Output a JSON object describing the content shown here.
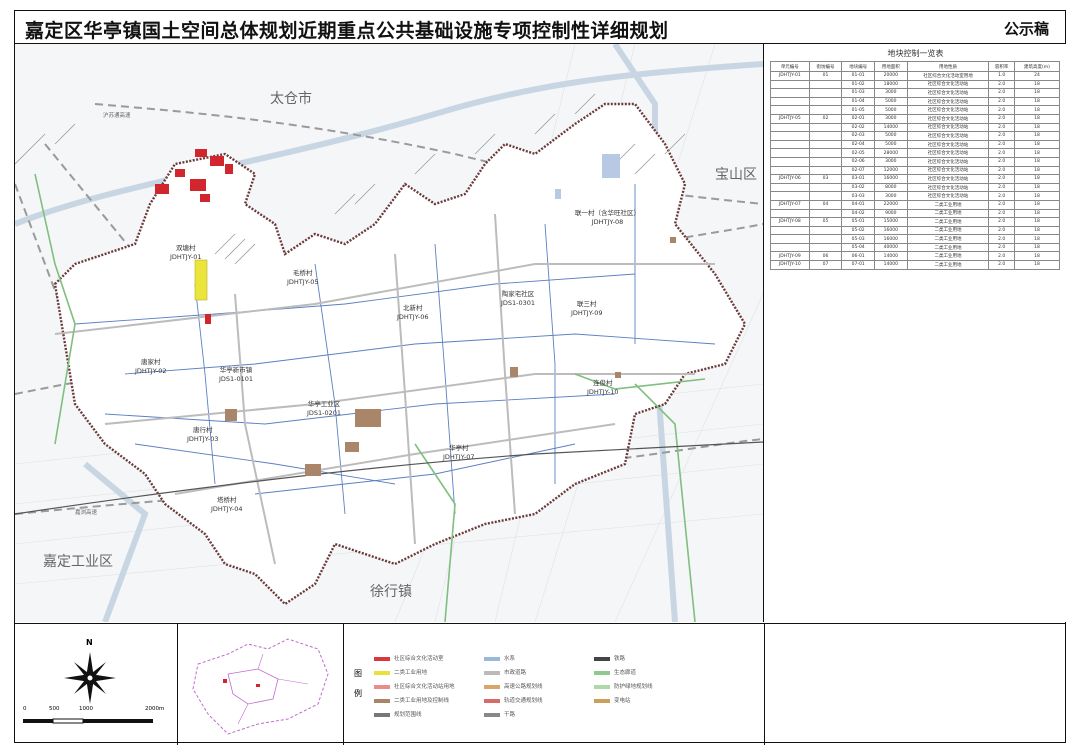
{
  "header": {
    "title": "嘉定区华亭镇国土空间总体规划近期重点公共基础设施专项控制性详细规划",
    "stamp": "公示稿"
  },
  "map": {
    "regions": {
      "taicang": "太仓市",
      "baoshan": "宝山区",
      "jiading_industrial": "嘉定工业区",
      "xuhang": "徐行镇"
    },
    "units": {
      "shuangtang": {
        "name": "双塘村",
        "code": "JDHTJY-01"
      },
      "maomu": {
        "name": "毛桥村",
        "code": "JDHTJY-05"
      },
      "beixiang": {
        "name": "北新村",
        "code": "JDHTJY-06"
      },
      "lianyi": {
        "name": "联一村（含华旺社区）",
        "code": "JDHTJY-08"
      },
      "tangjia": {
        "name": "唐家村",
        "code": "JDHTJY-02"
      },
      "market": {
        "name": "华亭新市镇",
        "code": "JDS1-0101"
      },
      "lianjie": {
        "name": "联三村",
        "code": "JDHTJY-09"
      },
      "taojia": {
        "name": "陶家宅社区",
        "code": "JDS1-0301"
      },
      "industrial": {
        "name": "华亭工业区",
        "code": "JDS1-0201"
      },
      "tanghang": {
        "name": "唐行村",
        "code": "JDHTJY-03"
      },
      "huating": {
        "name": "华亭村",
        "code": "JDHTJY-07"
      },
      "yuyan": {
        "name": "塔桥村",
        "code": "JDHTJY-04"
      },
      "shuangfu": {
        "name": "连俊村",
        "code": "JDHTJY-10"
      }
    },
    "roads": {
      "hu_yan": "沪苏通高速",
      "jia_yan": "嘉浏高速"
    }
  },
  "table": {
    "title": "地块控制一览表",
    "headers": [
      "单元编号",
      "街坊编号",
      "地块编号",
      "用地面积",
      "用地性质",
      "容积率",
      "建筑高度(m)"
    ],
    "rows": [
      [
        "JDHTJY-01",
        "01",
        "01-01",
        "20000",
        "社区综合文化活动室用地",
        "1.0",
        "24"
      ],
      [
        "",
        "",
        "01-02",
        "18000",
        "社区综合文化活动站",
        "2.0",
        "18"
      ],
      [
        "",
        "",
        "01-03",
        "3000",
        "社区综合文化活动站",
        "2.0",
        "18"
      ],
      [
        "",
        "",
        "01-04",
        "5000",
        "社区综合文化活动站",
        "2.0",
        "18"
      ],
      [
        "",
        "",
        "01-05",
        "5000",
        "社区综合文化活动站",
        "2.0",
        "18"
      ],
      [
        "JDHTJY-05",
        "02",
        "02-01",
        "3000",
        "社区综合文化活动站",
        "2.0",
        "18"
      ],
      [
        "",
        "",
        "02-02",
        "14000",
        "社区综合文化活动站",
        "2.0",
        "18"
      ],
      [
        "",
        "",
        "02-03",
        "5000",
        "社区综合文化活动站",
        "2.0",
        "18"
      ],
      [
        "",
        "",
        "02-04",
        "5000",
        "社区综合文化活动站",
        "2.0",
        "18"
      ],
      [
        "",
        "",
        "02-05",
        "28000",
        "社区综合文化活动站",
        "2.0",
        "18"
      ],
      [
        "",
        "",
        "02-06",
        "3000",
        "社区综合文化活动站",
        "2.0",
        "18"
      ],
      [
        "",
        "",
        "02-07",
        "12000",
        "社区综合文化活动站",
        "2.0",
        "18"
      ],
      [
        "JDHTJY-06",
        "03",
        "03-01",
        "16000",
        "社区综合文化活动站",
        "2.0",
        "18"
      ],
      [
        "",
        "",
        "03-02",
        "8000",
        "社区综合文化活动站",
        "2.0",
        "18"
      ],
      [
        "",
        "",
        "03-03",
        "3000",
        "社区综合文化活动站",
        "2.0",
        "18"
      ],
      [
        "JDHTJY-07",
        "04",
        "04-01",
        "22000",
        "二类工业用地",
        "2.0",
        "18"
      ],
      [
        "",
        "",
        "04-02",
        "9000",
        "二类工业用地",
        "2.0",
        "18"
      ],
      [
        "JDHTJY-08",
        "05",
        "05-01",
        "15000",
        "二类工业用地",
        "2.0",
        "18"
      ],
      [
        "",
        "",
        "05-02",
        "16000",
        "二类工业用地",
        "2.0",
        "18"
      ],
      [
        "",
        "",
        "05-03",
        "16000",
        "二类工业用地",
        "2.0",
        "18"
      ],
      [
        "",
        "",
        "05-04",
        "40000",
        "二类工业用地",
        "2.0",
        "18"
      ],
      [
        "JDHTJY-09",
        "06",
        "06-01",
        "14000",
        "二类工业用地",
        "2.0",
        "18"
      ],
      [
        "JDHTJY-10",
        "07",
        "07-01",
        "14000",
        "二类工业用地",
        "2.0",
        "18"
      ]
    ]
  },
  "compass": {
    "north": "N",
    "scale_labels": [
      "0",
      "500",
      "1000",
      "2000m"
    ]
  },
  "legend": {
    "title": "图例",
    "items": [
      {
        "label": "社区综合文化活动室",
        "color": "#d9363e"
      },
      {
        "label": "二类工业用地",
        "color": "#e8e23a"
      },
      {
        "label": "社区综合文化活动站用地",
        "color": "#e88c8c"
      },
      {
        "label": "二类工业用地及控制线",
        "color": "#a9866a"
      },
      {
        "label": "规划范围线",
        "color": "#777777"
      },
      {
        "label": "水系",
        "color": "#9bb8d8"
      },
      {
        "label": "市政道路",
        "color": "#bbbbbb"
      },
      {
        "label": "高速公路规划线",
        "color": "#d9a56a"
      },
      {
        "label": "轨道交通规划线",
        "color": "#d96a6a"
      },
      {
        "label": "干路",
        "color": "#888888"
      },
      {
        "label": "铁路",
        "color": "#444444"
      },
      {
        "label": "生态廊道",
        "color": "#8fc98f"
      },
      {
        "label": "防护绿地规划线",
        "color": "#b0d7a8"
      },
      {
        "label": "变电站",
        "color": "#c9a15a"
      }
    ]
  }
}
